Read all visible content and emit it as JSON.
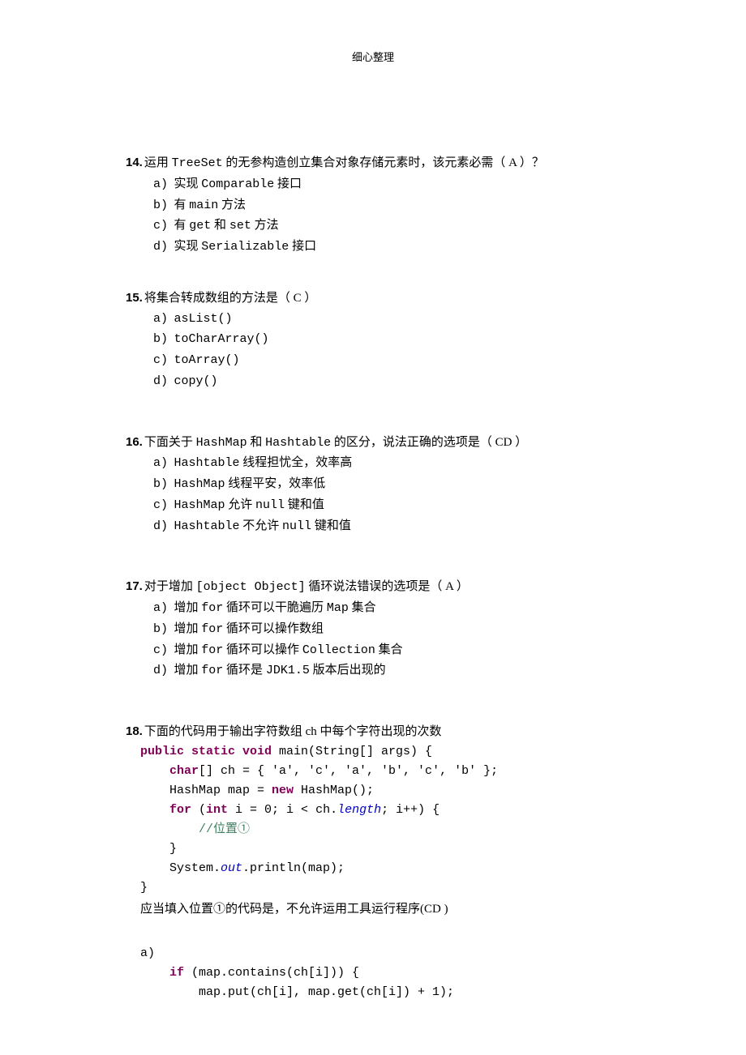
{
  "header": "细心整理",
  "q14": {
    "num": "14.",
    "text_pre": "运用 ",
    "code1": "TreeSet",
    "text_mid": " 的无参构造创立集合对象存储元素时，该元素必需（ A  ）？",
    "a": {
      "l": "a)",
      "pre": "实现 ",
      "c": "Comparable",
      "post": " 接口"
    },
    "b": {
      "l": "b)",
      "pre": "有 ",
      "c": "main",
      "post": " 方法"
    },
    "c": {
      "l": "c)",
      "pre": "有 ",
      "c1": "get",
      "mid": " 和 ",
      "c2": "set",
      "post": " 方法"
    },
    "d": {
      "l": "d)",
      "pre": "实现 ",
      "c": "Serializable",
      "post": " 接口"
    }
  },
  "q15": {
    "num": "15.",
    "text": "将集合转成数组的方法是（ C ）",
    "a": {
      "l": "a)",
      "c": "asList()"
    },
    "b": {
      "l": "b)",
      "c": "toCharArray()"
    },
    "c": {
      "l": "c)",
      "c": "toArray()"
    },
    "d": {
      "l": "d)",
      "c": "copy()"
    }
  },
  "q16": {
    "num": "16.",
    "pre": "下面关于 ",
    "c1": "HashMap",
    "mid": " 和 ",
    "c2": "Hashtable",
    "post": " 的区分，说法正确的选项是（ CD ）",
    "a": {
      "l": "a)",
      "c": "Hashtable",
      "post": " 线程担忧全，效率高"
    },
    "b": {
      "l": "b)",
      "c": "HashMap",
      "post": " 线程平安，效率低"
    },
    "c": {
      "l": "c)",
      "c": "HashMap",
      "mid": " 允许 ",
      "c2": "null",
      "post": " 键和值"
    },
    "d": {
      "l": "d)",
      "c": "Hashtable",
      "mid": " 不允许 ",
      "c2": "null",
      "post": " 键和值"
    }
  },
  "q17": {
    "num": "17.",
    "pre": "对于增加 ",
    "c": {
      "l": "c)",
      "pre": "增加 ",
      "c": "for",
      "mid": " 循环可以操作 ",
      "c2": "Collection",
      "post": " 集合"
    },
    "post": " 循环说法错误的选项是（ A   ）",
    "a": {
      "l": "a)",
      "pre": "增加 ",
      "c": "for",
      "mid": " 循环可以干脆遍历 ",
      "c2": "Map",
      "post": " 集合"
    },
    "b": {
      "l": "b)",
      "pre": "增加 ",
      "c": "for",
      "post": " 循环可以操作数组"
    },
    "d": {
      "l": "d)",
      "pre": "增加 ",
      "c": "for",
      "mid": " 循环是 ",
      "c2": "JDK1.5",
      "post": " 版本后出现的"
    }
  },
  "q18": {
    "num": "18.",
    "text": "下面的代码用于输出字符数组 ch 中每个字符出现的次数",
    "l1": {
      "kw": "public static void",
      "rest": " main(String[] args) {"
    },
    "l2": {
      "kw": "char",
      "rest": "[] ch = { 'a', 'c', 'a', 'b', 'c', 'b' };"
    },
    "l3": {
      "pre": "HashMap map = ",
      "kw": "new",
      "post": " HashMap();"
    },
    "l4": {
      "kw1": "for",
      "mid": " (",
      "kw2": "int",
      "post1": " i = 0; i < ch.",
      "it": "length",
      "post2": "; i++) {"
    },
    "l5": {
      "cm": "//位置①"
    },
    "l6": "}",
    "l7": {
      "pre": "System.",
      "it": "out",
      "post": ".println(map);"
    },
    "l8": "}",
    "after": "应当填入位置①的代码是，不允许运用工具运行程序(CD  )",
    "oa": "a)",
    "oa1": {
      "kw": "if",
      "rest": " (map.contains(ch[i])) {"
    },
    "oa2": "map.put(ch[i], map.get(ch[i]) + 1);"
  }
}
